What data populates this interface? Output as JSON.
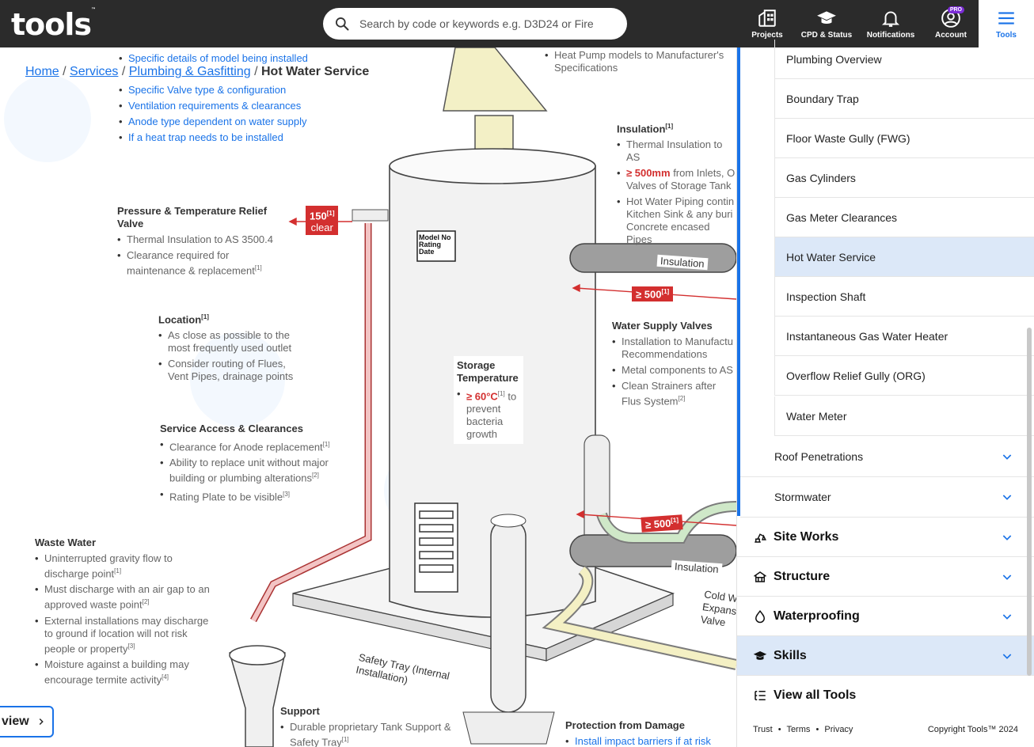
{
  "header": {
    "logo": "tools",
    "logo_tm": "™",
    "search_placeholder": "Search by code or keywords e.g. D3D24 or Fire",
    "nav": [
      {
        "label": "Projects",
        "icon": "building-icon"
      },
      {
        "label": "CPD & Status",
        "icon": "graduation-cap-icon"
      },
      {
        "label": "Notifications",
        "icon": "bell-icon"
      },
      {
        "label": "Account",
        "icon": "user-circle-icon",
        "badge": "PRO"
      },
      {
        "label": "Tools",
        "icon": "hamburger-icon"
      }
    ]
  },
  "breadcrumb": {
    "home": "Home",
    "services": "Services",
    "plumbing": "Plumbing & Gasfitting",
    "current": "Hot Water Service",
    "sep": "/"
  },
  "diagram": {
    "top_cut": "Specific details of model being installed",
    "top_list": [
      "Specific Valve type & configuration",
      "Ventilation requirements & clearances",
      "Anode type dependent on water supply",
      "If a heat trap needs to be installed"
    ],
    "heat_pump": "Heat Pump models to Manufacturer's Specifications",
    "insulation": {
      "title": "Insulation",
      "ref": "[1]",
      "items": [
        "Thermal Insulation to AS",
        "from Inlets, O Valves of Storage Tank",
        "Hot Water Piping contin Kitchen Sink & any buri Concrete encased Pipes"
      ],
      "highlight": "≥ 500mm"
    },
    "ptr_valve": {
      "title": "Pressure & Temperature Relief Valve",
      "items": [
        "Thermal Insulation to AS 3500.4",
        "Clearance required for maintenance & replacement"
      ],
      "ref": "[1]"
    },
    "tag_150": "150",
    "tag_150_ref": "[1]",
    "tag_clear": "clear",
    "model_plate": "Model No Rating Date",
    "insulation_label": "Insulation",
    "tag_500": "≥ 500",
    "tag_500_ref": "[1]",
    "location": {
      "title": "Location",
      "ref": "[1]",
      "items": [
        "As close as possible to the most frequently used outlet",
        "Consider routing of Flues, Vent Pipes, drainage points"
      ]
    },
    "water_supply": {
      "title": "Water Supply Valves",
      "items": [
        "Installation to Manufactu Recommendations",
        "Metal components to AS",
        "Clean Strainers after Flus System"
      ],
      "ref2": "[2]"
    },
    "storage": {
      "title": "Storage Temperature",
      "highlight": "≥ 60°C",
      "ref": "[1]",
      "text": "to prevent bacteria growth"
    },
    "service_access": {
      "title": "Service Access & Clearances",
      "items": [
        "Clearance for Anode replacement",
        "Ability to replace unit without major building or plumbing alterations",
        "Rating Plate to be visible"
      ],
      "refs": [
        "[1]",
        "[2]",
        "[3]"
      ]
    },
    "waste_water": {
      "title": "Waste Water",
      "items": [
        "Uninterrupted gravity flow to discharge point",
        "Must discharge with an air gap to an approved waste point",
        "External installations may discharge to ground if location will not risk people or property",
        "Moisture against a building may encourage termite activity"
      ],
      "refs": [
        "[1]",
        "[2]",
        "[3]",
        "[4]"
      ]
    },
    "cold_water": "Cold W Expans Valve",
    "safety_tray": "Safety Tray (Internal Installation)",
    "support": {
      "title": "Support",
      "text": "Durable proprietary Tank Support & Safety Tray",
      "ref": "[1]"
    },
    "protection": {
      "title": "Protection from Damage",
      "item": "Install impact barriers if at risk"
    },
    "overview_button": "view"
  },
  "panel": {
    "subitems": [
      "Plumbing Overview",
      "Boundary Trap",
      "Floor Waste Gully (FWG)",
      "Gas Cylinders",
      "Gas Meter Clearances",
      "Hot Water Service",
      "Inspection Shaft",
      "Instantaneous Gas Water Heater",
      "Overflow Relief Gully (ORG)",
      "Water Meter"
    ],
    "active_subitem": "Hot Water Service",
    "groups": [
      "Roof Penetrations",
      "Stormwater"
    ],
    "sections": [
      {
        "label": "Site Works",
        "icon": "excavator-icon"
      },
      {
        "label": "Structure",
        "icon": "house-frame-icon"
      },
      {
        "label": "Waterproofing",
        "icon": "droplet-icon"
      },
      {
        "label": "Skills",
        "icon": "graduation-cap-icon"
      }
    ],
    "view_all": "View all Tools",
    "footer_links": [
      "Trust",
      "Terms",
      "Privacy"
    ],
    "footer_sep": "•",
    "copyright": "Copyright Tools™ 2024"
  },
  "colors": {
    "accent": "#1a73e8",
    "header_bg": "#2b2b2b",
    "active_bg": "#dce8f8",
    "red": "#d32f2f"
  }
}
